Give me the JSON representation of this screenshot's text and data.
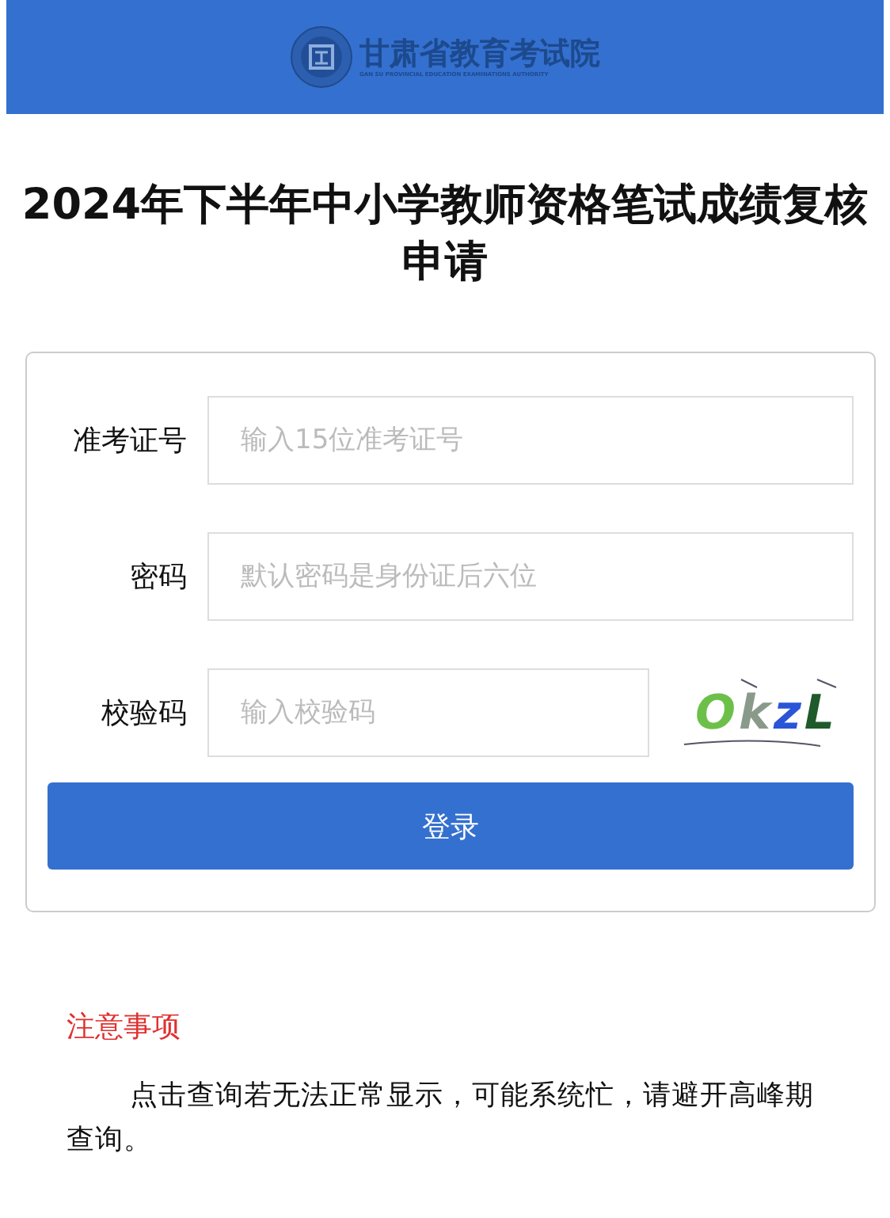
{
  "header": {
    "logo_name": "甘肃省教育考试院",
    "logo_subtitle": "GAN SU PROVINCIAL EDUCATION EXAMINATIONS AUTHORITY"
  },
  "title": "2024年下半年中小学教师资格笔试成绩复核申请",
  "form": {
    "fields": [
      {
        "label": "准考证号",
        "placeholder": "输入15位准考证号",
        "kind": "text"
      },
      {
        "label": "密码",
        "placeholder": "默认密码是身份证后六位",
        "kind": "text"
      },
      {
        "label": "校验码",
        "placeholder": "输入校验码",
        "kind": "captcha"
      }
    ],
    "captcha": {
      "letters": [
        {
          "char": "O",
          "color": "#6cc04a"
        },
        {
          "char": "k",
          "color": "#8a9a8a"
        },
        {
          "char": "z",
          "color": "#2a55d8"
        },
        {
          "char": "L",
          "color": "#1f5a2a"
        }
      ]
    },
    "submit": "登录"
  },
  "notice": {
    "heading": "注意事项",
    "text": "点击查询若无法正常显示，可能系统忙，请避开高峰期查询。"
  }
}
